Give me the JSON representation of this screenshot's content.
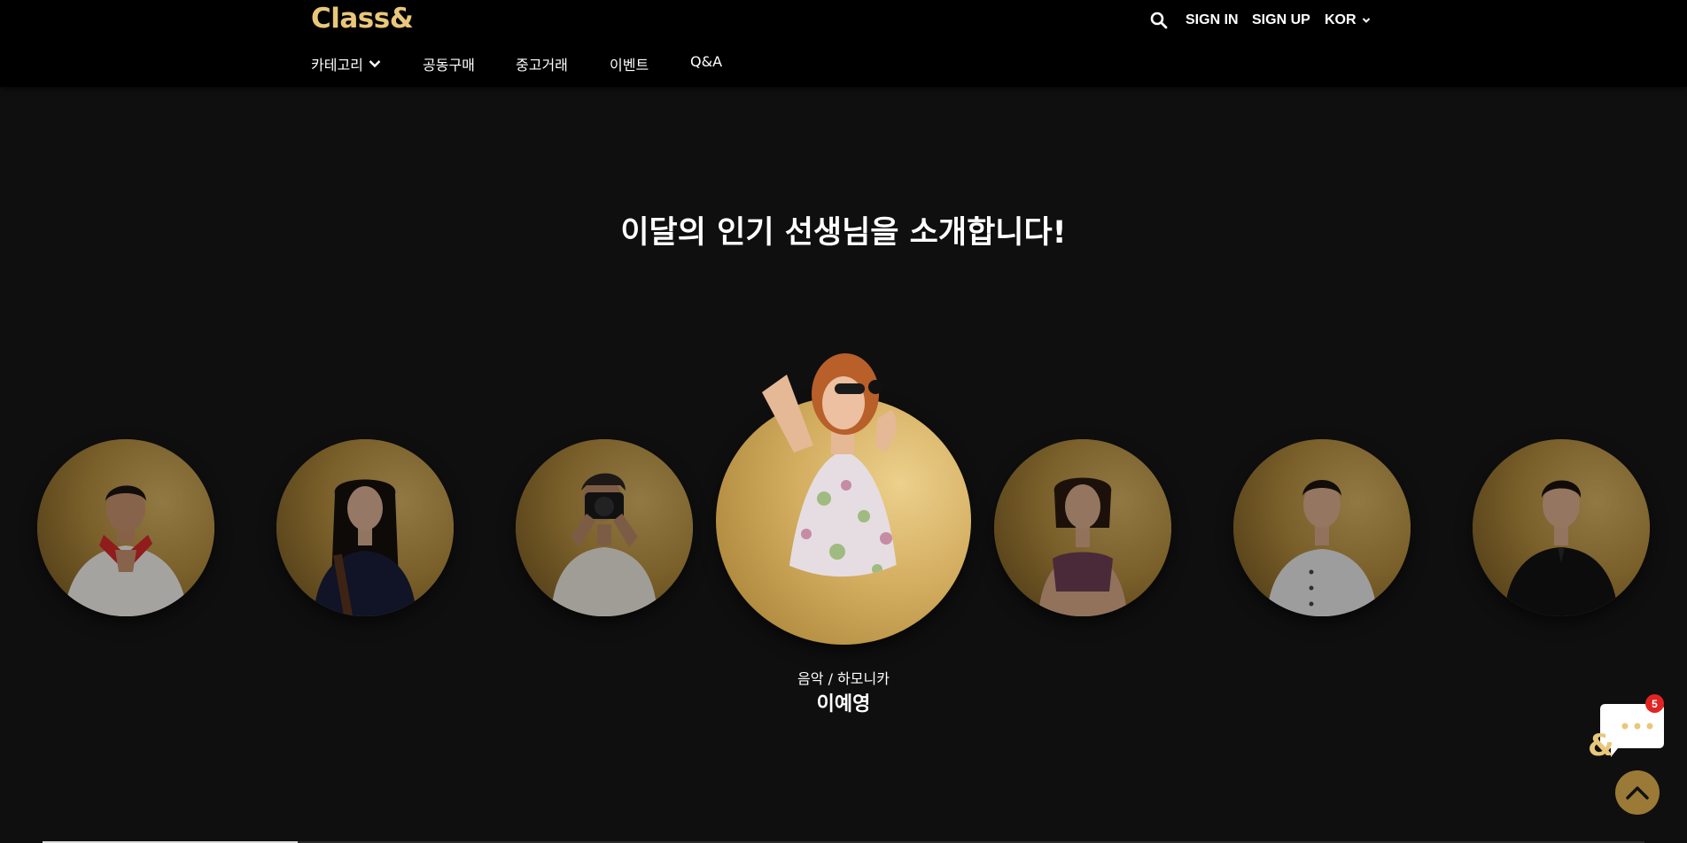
{
  "header": {
    "logo": "Class&",
    "search_icon": "search-icon",
    "sign_in": "SIGN IN",
    "sign_up": "SIGN UP",
    "language": "KOR",
    "nav": [
      {
        "label": "카테고리",
        "has_dropdown": true
      },
      {
        "label": "공동구매"
      },
      {
        "label": "중고거래"
      },
      {
        "label": "이벤트"
      },
      {
        "label": "Q&A"
      }
    ]
  },
  "colors": {
    "background": "#0f0f0f",
    "accent_gold": "#e9c77a",
    "badge_red": "#e02424"
  },
  "section": {
    "title": "이달의 인기 선생님을 소개합니다!"
  },
  "teachers": [
    {
      "photo": "chef-with-red-scarf"
    },
    {
      "photo": "violinist-woman"
    },
    {
      "photo": "photographer-with-camera"
    },
    {
      "photo": "singer-with-microphone",
      "featured": true
    },
    {
      "photo": "fitness-trainer-woman"
    },
    {
      "photo": "chef-in-white-uniform"
    },
    {
      "photo": "man-in-black-shirt"
    }
  ],
  "featured": {
    "category": "음악 / 하모니카",
    "name": "이예영"
  },
  "chat": {
    "badge_count": "5",
    "icon": "chat-bubble-icon"
  },
  "scroll_top_icon": "chevron-up-icon"
}
